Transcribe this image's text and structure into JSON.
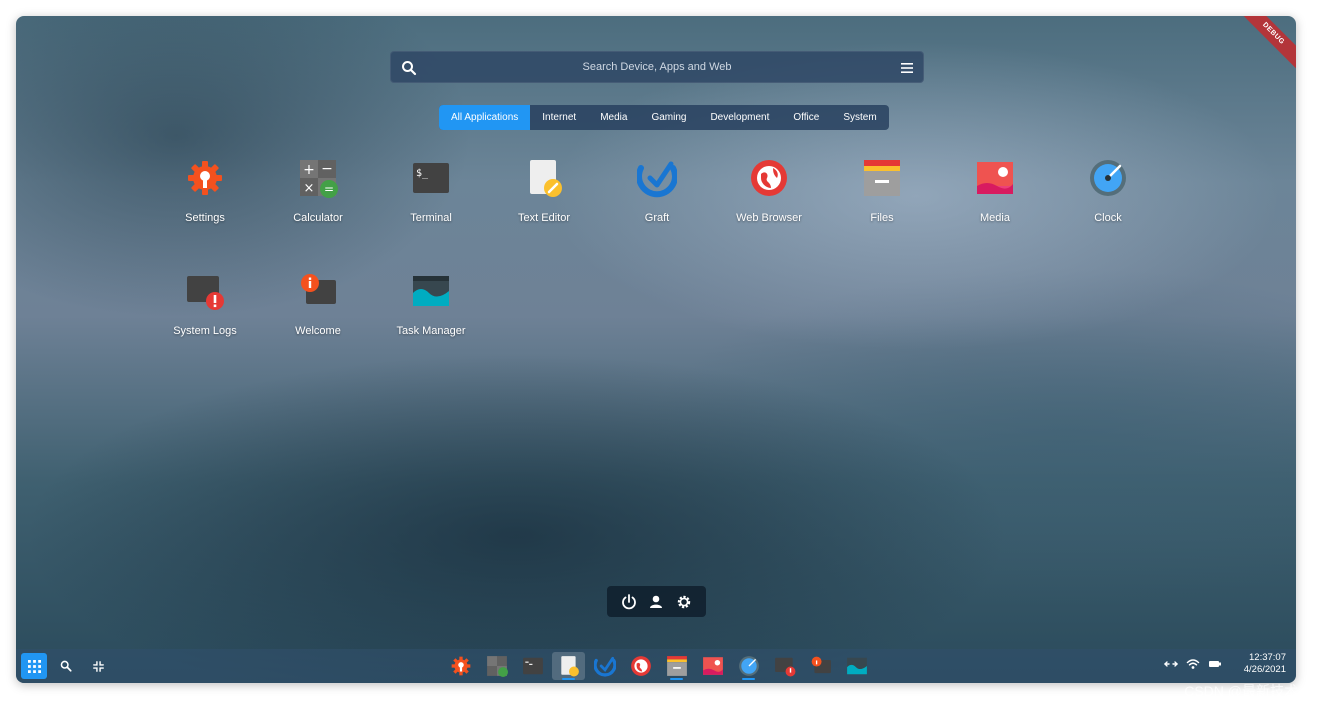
{
  "search": {
    "placeholder": "Search Device, Apps and Web"
  },
  "ribbon": {
    "label": "DEBUG"
  },
  "tabs": [
    "All Applications",
    "Internet",
    "Media",
    "Gaming",
    "Development",
    "Office",
    "System"
  ],
  "apps": [
    {
      "label": "Settings",
      "icon": "settings-icon"
    },
    {
      "label": "Calculator",
      "icon": "calculator-icon"
    },
    {
      "label": "Terminal",
      "icon": "terminal-icon"
    },
    {
      "label": "Text Editor",
      "icon": "text-editor-icon"
    },
    {
      "label": "Graft",
      "icon": "graft-icon"
    },
    {
      "label": "Web Browser",
      "icon": "web-browser-icon"
    },
    {
      "label": "Files",
      "icon": "files-icon"
    },
    {
      "label": "Media",
      "icon": "media-icon"
    },
    {
      "label": "Clock",
      "icon": "clock-icon"
    },
    {
      "label": "System Logs",
      "icon": "system-logs-icon"
    },
    {
      "label": "Welcome",
      "icon": "welcome-icon"
    },
    {
      "label": "Task Manager",
      "icon": "task-manager-icon"
    }
  ],
  "terminal_glyph": "$_",
  "taskbar": {
    "time": "12:37:07",
    "date": "4/26/2021"
  },
  "watermark": "CSDN @最新技术",
  "colors": {
    "accent": "#2196f3",
    "settings": "#f4511e",
    "calculator_green": "#43a047",
    "browser_red": "#e53935",
    "media_pink": "#ec407a",
    "task_teal": "#00acc1"
  }
}
